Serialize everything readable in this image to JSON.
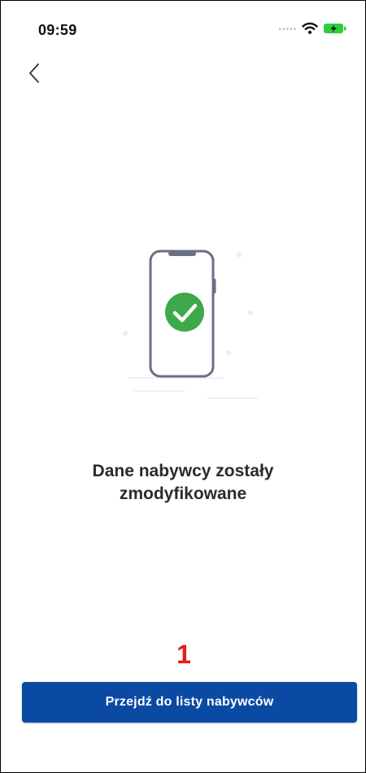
{
  "status_bar": {
    "time": "09:59",
    "signal_icon": "cellular-signal-dots",
    "wifi_icon": "wifi-icon",
    "battery_icon": "battery-charging-icon",
    "battery_color": "#2ecc40"
  },
  "nav": {
    "back_icon": "chevron-left-icon"
  },
  "illustration": {
    "icon": "phone-checkmark-illustration",
    "check_color": "#3ea84b"
  },
  "message": {
    "line1": "Dane nabywcy zostały",
    "line2": "zmodyfikowane"
  },
  "annotation": {
    "label": "1",
    "color": "#e01f1f"
  },
  "primary_action": {
    "label": "Przejdź do listy nabywców",
    "color": "#0b4aa2"
  }
}
